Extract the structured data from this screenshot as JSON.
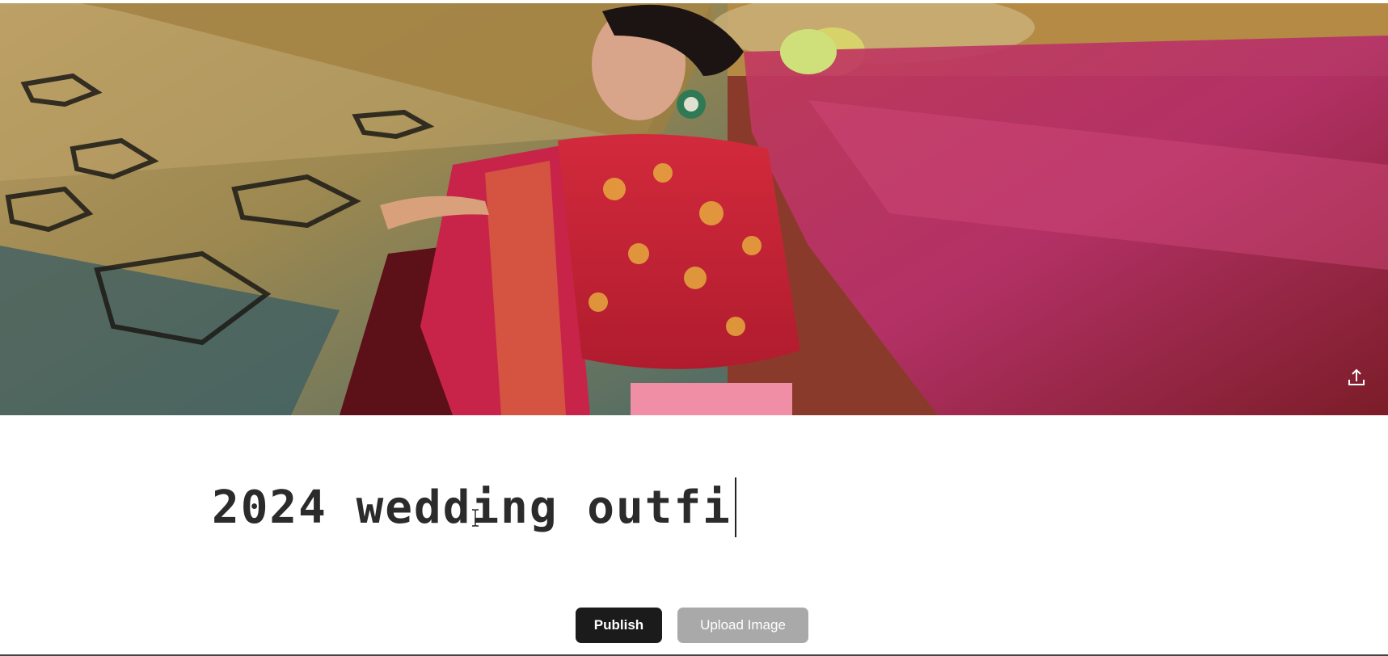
{
  "hero": {
    "image_alt": "Woman in red embroidered lehenga with a flowing pink dupatta on a patterned carpet",
    "upload_icon": "upload-icon"
  },
  "editor": {
    "title_value": "2024 wedding outfi"
  },
  "actions": {
    "publish_label": "Publish",
    "upload_label": "Upload Image"
  },
  "colors": {
    "publish_bg": "#1b1b1b",
    "upload_bg": "#a9a9a9",
    "title_text": "#2b2b2b"
  }
}
